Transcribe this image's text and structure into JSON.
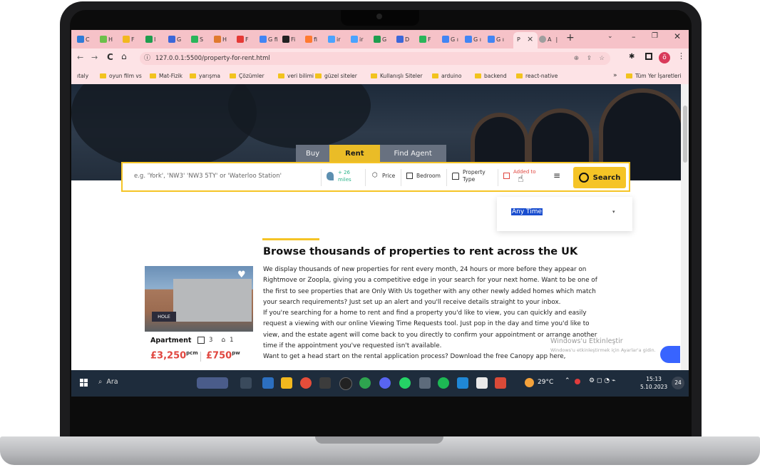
{
  "browser": {
    "tabs_short": [
      "C",
      "H",
      "F",
      "I",
      "G",
      "S",
      "H",
      "F",
      "G fi",
      "Fi",
      "fi",
      "ir",
      "ir",
      "G",
      "D",
      "F",
      "G ı",
      "G ı",
      "G ı",
      "P",
      "A"
    ],
    "close_glyph": "×",
    "new_tab_glyph": "+",
    "url": "127.0.0.1:5500/property-for-rent.html",
    "profile_initial": "ö",
    "bookmarks": [
      "ıtaly",
      "oyun film vs",
      "Mat-Fizik",
      "yarışma",
      "Çözümler",
      "veri bilimi",
      "güzel siteler",
      "Kullanışlı Siteler",
      "arduino",
      "backend",
      "react-native"
    ],
    "bookmarks_overflow": "»",
    "all_bookmarks": "Tüm Yer İşaretleri"
  },
  "search_tabs": [
    "Buy",
    "Rent",
    "Find Agent"
  ],
  "search": {
    "placeholder": "e.g. 'York', 'NW3' 'NW3 5TY' or 'Waterloo Station'",
    "radius": "+ 26 miles",
    "price_label": "Price",
    "bedroom_label": "Bedroom",
    "property_type_label": "Property Type",
    "added_to_label": "Added to",
    "button_label": "Search"
  },
  "dropdown": {
    "selected": "Any Time"
  },
  "main": {
    "heading": "Browse thousands of properties to rent across the UK",
    "paragraph": "We display thousands of new properties for rent every month, 24 hours or more before they appear on Rightmove or Zoopla, giving you a competitive edge in your search for your next home. Want to be one of the first to see properties that are Only With Us together with any other newly added homes which match your search requirements? Just set up an alert and you'll receive details straight to your inbox.",
    "paragraph2": "If you're searching for a home to rent and find a property you'd like to view, you can quickly and easily request a viewing with our online Viewing Time Requests tool. Just pop in the day and time you'd like to view, and the estate agent will come back to you directly to confirm your appointment or arrange another time if the appointment you've requested isn't available.",
    "paragraph3": "Want to get a head start on the rental application process? Download the free Canopy app here,"
  },
  "card": {
    "logo_text": "HOLE",
    "type": "Apartment",
    "bedrooms": "3",
    "bathrooms": "1",
    "price_pcm": "£3,250",
    "pcm_label": "pcm",
    "price_pw": "£750",
    "pw_label": "pw"
  },
  "windows_watermark": {
    "title": "Windows'u Etkinleştir",
    "subtitle": "Windows'u etkinleştirmek için Ayarlar'a gidin."
  },
  "taskbar": {
    "search_label": "Ara",
    "temperature": "29°C",
    "time": "15:13",
    "date": "5.10.2023",
    "notif_count": "24"
  },
  "colors": {
    "accent": "#f5c426",
    "price": "#e0463f",
    "tabbar": "#f6c2c8"
  }
}
